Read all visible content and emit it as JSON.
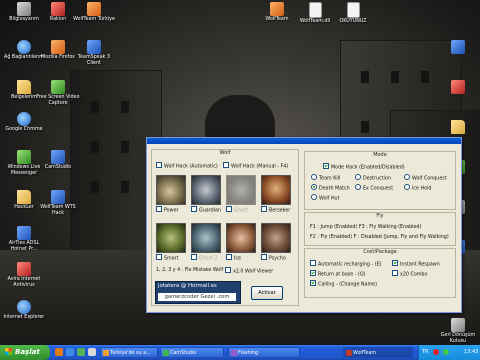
{
  "desktop": {
    "icons_left": [
      {
        "label": "Bilgisayarım",
        "icon": "my-computer-icon",
        "color": "gray"
      },
      {
        "label": "Rakion",
        "icon": "rakion-game-icon",
        "color": "red"
      },
      {
        "label": "WolfTeam Türkiye",
        "icon": "wolfteam-icon",
        "color": "orange"
      },
      {
        "label": "Ağ Bağlantılarım",
        "icon": "network-icon",
        "color": "globe"
      },
      {
        "label": "Mozilla Firefox",
        "icon": "firefox-icon",
        "color": "orange"
      },
      {
        "label": "TeamSpeak 3 Client",
        "icon": "teamspeak-icon",
        "color": "blue"
      },
      {
        "label": "Belgelerim",
        "icon": "documents-folder-icon",
        "color": "folder"
      },
      {
        "label": "Free Screen Video Capture",
        "icon": "video-capture-icon",
        "color": "green"
      },
      {
        "label": "Google Chrome",
        "icon": "chrome-icon",
        "color": "globe"
      },
      {
        "label": "Windows Live Messenger",
        "icon": "messenger-icon",
        "color": "green"
      },
      {
        "label": "CamStudio",
        "icon": "camstudio-icon",
        "color": "blue"
      },
      {
        "label": "HackLer",
        "icon": "folder-icon",
        "color": "folder"
      },
      {
        "label": "WolfTeam WTS Hack",
        "icon": "hack-icon",
        "color": "blue"
      },
      {
        "label": "AirTies ADSL Hotnet Pr...",
        "icon": "airties-icon",
        "color": "blue"
      },
      {
        "label": "Avira Internet Antivirus",
        "icon": "antivirus-icon",
        "color": "red"
      },
      {
        "label": "Internet Explorer",
        "icon": "ie-icon",
        "color": "globe"
      }
    ],
    "icons_top_right": [
      {
        "label": "WolfTeam",
        "icon": "wolfteam-icon"
      },
      {
        "label": "WolfTeam.dll",
        "icon": "dll-file-icon"
      },
      {
        "label": "OKUYUNUZ",
        "icon": "text-file-icon"
      }
    ],
    "icons_right": [
      {
        "label": "",
        "icon": "app-icon-1"
      },
      {
        "label": "",
        "icon": "app-icon-2"
      },
      {
        "label": "",
        "icon": "app-icon-3"
      },
      {
        "label": "",
        "icon": "app-icon-4"
      },
      {
        "label": "",
        "icon": "app-icon-5"
      },
      {
        "label": "",
        "icon": "app-icon-6"
      }
    ],
    "recycle_bin": "Geri Dönüşüm Kutusu"
  },
  "hack_window": {
    "wolf": {
      "header": "Wolf",
      "auto": "Wolf Hack (Automatic)",
      "manual": "Wolf Hack (Manual - F4)",
      "monsters": [
        {
          "label": "Power",
          "checked": false,
          "disabled": false
        },
        {
          "label": "Guardian",
          "checked": false,
          "disabled": false
        },
        {
          "label": "Ghost",
          "checked": false,
          "disabled": true
        },
        {
          "label": "Berseker",
          "checked": false,
          "disabled": false
        },
        {
          "label": "Smart",
          "checked": false,
          "disabled": false
        },
        {
          "label": "Ghost 2",
          "checked": false,
          "disabled": true
        },
        {
          "label": "Ice",
          "checked": false,
          "disabled": false
        },
        {
          "label": "Psycho",
          "checked": false,
          "disabled": false
        }
      ],
      "hint": "1, 2, 3 y 4 : Fix Mistake Wolf",
      "viewer": "x2.0 Wolf Viewer"
    },
    "mode": {
      "header": "Mode",
      "enable": "Mode Hack (Enabled/Disabled)",
      "options": [
        {
          "label": "Team Kill",
          "selected": false
        },
        {
          "label": "Destruction",
          "selected": false
        },
        {
          "label": "Wolf Conquest",
          "selected": false
        },
        {
          "label": "Death Match",
          "selected": true
        },
        {
          "label": "Ex Conquest",
          "selected": false
        },
        {
          "label": "Ice Hold",
          "selected": false
        },
        {
          "label": "Wolf Hut",
          "selected": false
        }
      ]
    },
    "fly": {
      "header": "Fly",
      "line1": "F1 : Jump (Enabled) F3 : Fly Walking (Enabled)",
      "line2": "F2 : Fly (Enabled)   F : Disabled (Jump, Fly and Fly Walking)"
    },
    "pack": {
      "header": "Cost/Package",
      "items": [
        {
          "label": "Automatic recharging - (E)",
          "checked": false
        },
        {
          "label": "Instant Respawn",
          "checked": true
        },
        {
          "label": "Return at base - (Q)",
          "checked": true
        },
        {
          "label": "x20 Combo",
          "checked": false
        },
        {
          "label": "Calling - (Change Name)",
          "checked": true
        }
      ]
    },
    "contact": {
      "email": "jotatera @ Hotmail.es",
      "site": "gamerzcoder Gezel .com"
    },
    "activate_button": "Activar"
  },
  "taskbar": {
    "start_label": "Başlat",
    "tasks": [
      {
        "label": "Türkiye'de su a...",
        "active": false
      },
      {
        "label": "CamStudio",
        "active": false
      },
      {
        "label": "Flashing",
        "active": false
      },
      {
        "label": "WolfTeam",
        "active": true
      }
    ],
    "tray": {
      "lang": "TR",
      "time": "13:43"
    }
  }
}
